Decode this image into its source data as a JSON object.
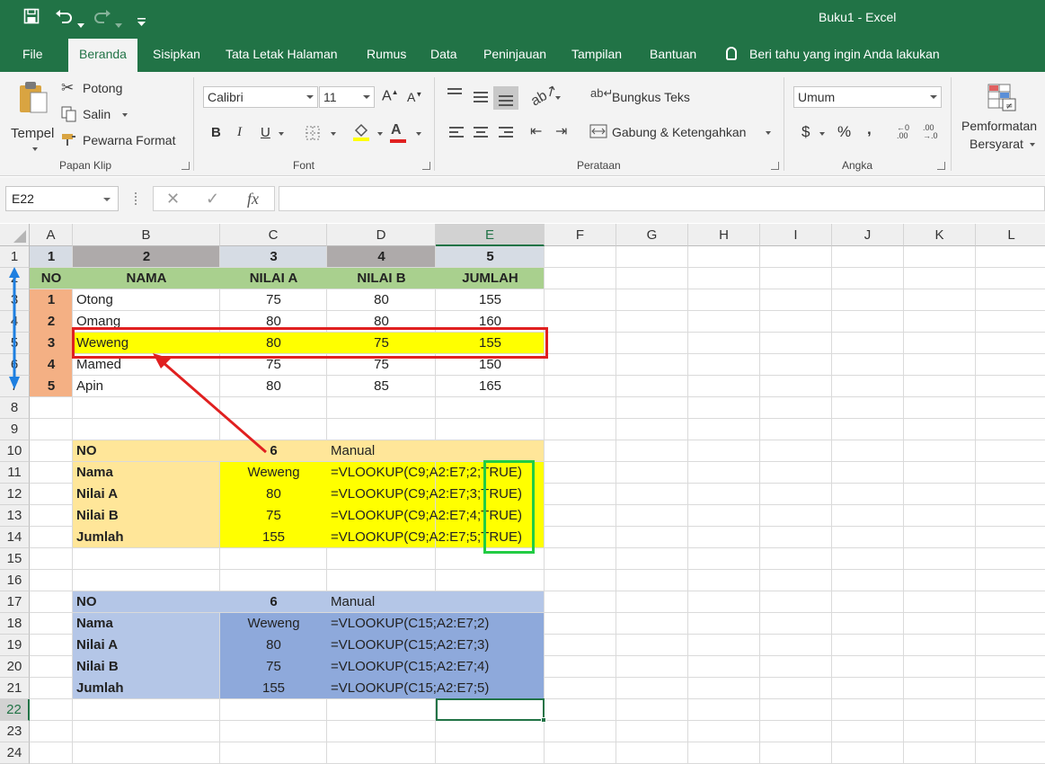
{
  "window": {
    "title": "Buku1  -  Excel"
  },
  "quick_access": {
    "save": "save-icon",
    "undo": "undo-icon",
    "redo": "redo-icon",
    "customize": "customize-icon"
  },
  "tabs": [
    "File",
    "Beranda",
    "Sisipkan",
    "Tata Letak Halaman",
    "Rumus",
    "Data",
    "Peninjauan",
    "Tampilan",
    "Bantuan"
  ],
  "tell_me": "Beri tahu yang ingin Anda lakukan",
  "ribbon": {
    "clipboard": {
      "paste": "Tempel",
      "cut": "Potong",
      "copy": "Salin",
      "format_painter": "Pewarna Format",
      "label": "Papan Klip"
    },
    "font": {
      "name": "Calibri",
      "size": "11",
      "label": "Font",
      "bold": "B",
      "italic": "I",
      "underline": "U"
    },
    "alignment": {
      "wrap": "Bungkus Teks",
      "merge": "Gabung & Ketengahkan",
      "label": "Perataan"
    },
    "number": {
      "format": "Umum",
      "currency": "$",
      "percent": "%",
      "comma": ",",
      "label": "Angka"
    },
    "styles": {
      "conditional_line1": "Pemformatan",
      "conditional_line2": "Bersyarat"
    }
  },
  "formula_bar": {
    "name_box": "E22",
    "fx": "fx",
    "cancel": "✕",
    "enter": "✓",
    "formula": ""
  },
  "columns": [
    "A",
    "B",
    "C",
    "D",
    "E",
    "F",
    "G",
    "H",
    "I",
    "J",
    "K",
    "L"
  ],
  "rows": [
    "1",
    "2",
    "3",
    "4",
    "5",
    "6",
    "7",
    "8",
    "9",
    "10",
    "11",
    "12",
    "13",
    "14",
    "15",
    "16",
    "17",
    "18",
    "19",
    "20",
    "21",
    "22",
    "23",
    "24"
  ],
  "selected_cell": {
    "column": "E",
    "row": "22"
  },
  "sheet": {
    "header_numbers": [
      "1",
      "2",
      "3",
      "4",
      "5"
    ],
    "table_headers": [
      "NO",
      "NAMA",
      "NILAI A",
      "NILAI B",
      "JUMLAH"
    ],
    "table_rows": [
      [
        "1",
        "Otong",
        "75",
        "80",
        "155"
      ],
      [
        "2",
        "Omang",
        "80",
        "80",
        "160"
      ],
      [
        "3",
        "Weweng",
        "80",
        "75",
        "155"
      ],
      [
        "4",
        "Mamed",
        "75",
        "75",
        "150"
      ],
      [
        "5",
        "Apin",
        "80",
        "85",
        "165"
      ]
    ],
    "lookup1": {
      "no_label": "NO",
      "no_value": "6",
      "mode": "Manual",
      "rows": [
        {
          "label": "Nama",
          "value": "Weweng",
          "formula": "=VLOOKUP(C9;A2:E7;2;TRUE)"
        },
        {
          "label": "Nilai A",
          "value": "80",
          "formula": "=VLOOKUP(C9;A2:E7;3;TRUE)"
        },
        {
          "label": "Nilai B",
          "value": "75",
          "formula": "=VLOOKUP(C9;A2:E7;4;TRUE)"
        },
        {
          "label": "Jumlah",
          "value": "155",
          "formula": "=VLOOKUP(C9;A2:E7;5;TRUE)"
        }
      ]
    },
    "lookup2": {
      "no_label": "NO",
      "no_value": "6",
      "mode": "Manual",
      "rows": [
        {
          "label": "Nama",
          "value": "Weweng",
          "formula": "=VLOOKUP(C15;A2:E7;2)"
        },
        {
          "label": "Nilai A",
          "value": "80",
          "formula": "=VLOOKUP(C15;A2:E7;3)"
        },
        {
          "label": "Nilai B",
          "value": "75",
          "formula": "=VLOOKUP(C15;A2:E7;4)"
        },
        {
          "label": "Jumlah",
          "value": "155",
          "formula": "=VLOOKUP(C15;A2:E7;5)"
        }
      ]
    }
  },
  "colors": {
    "excel_green": "#217346",
    "gray_header": "#aeaaaa",
    "light_blue_header": "#d6dce4",
    "green_header": "#a9d08e",
    "orange_no": "#f4b084",
    "yellow": "#ffff00",
    "peach": "#ffe699",
    "blue_light": "#b4c6e7",
    "blue_mid": "#8ea9db",
    "highlight_red": "#e02020",
    "highlight_green": "#22cc44",
    "arrow_blue": "#1e7fe0"
  }
}
